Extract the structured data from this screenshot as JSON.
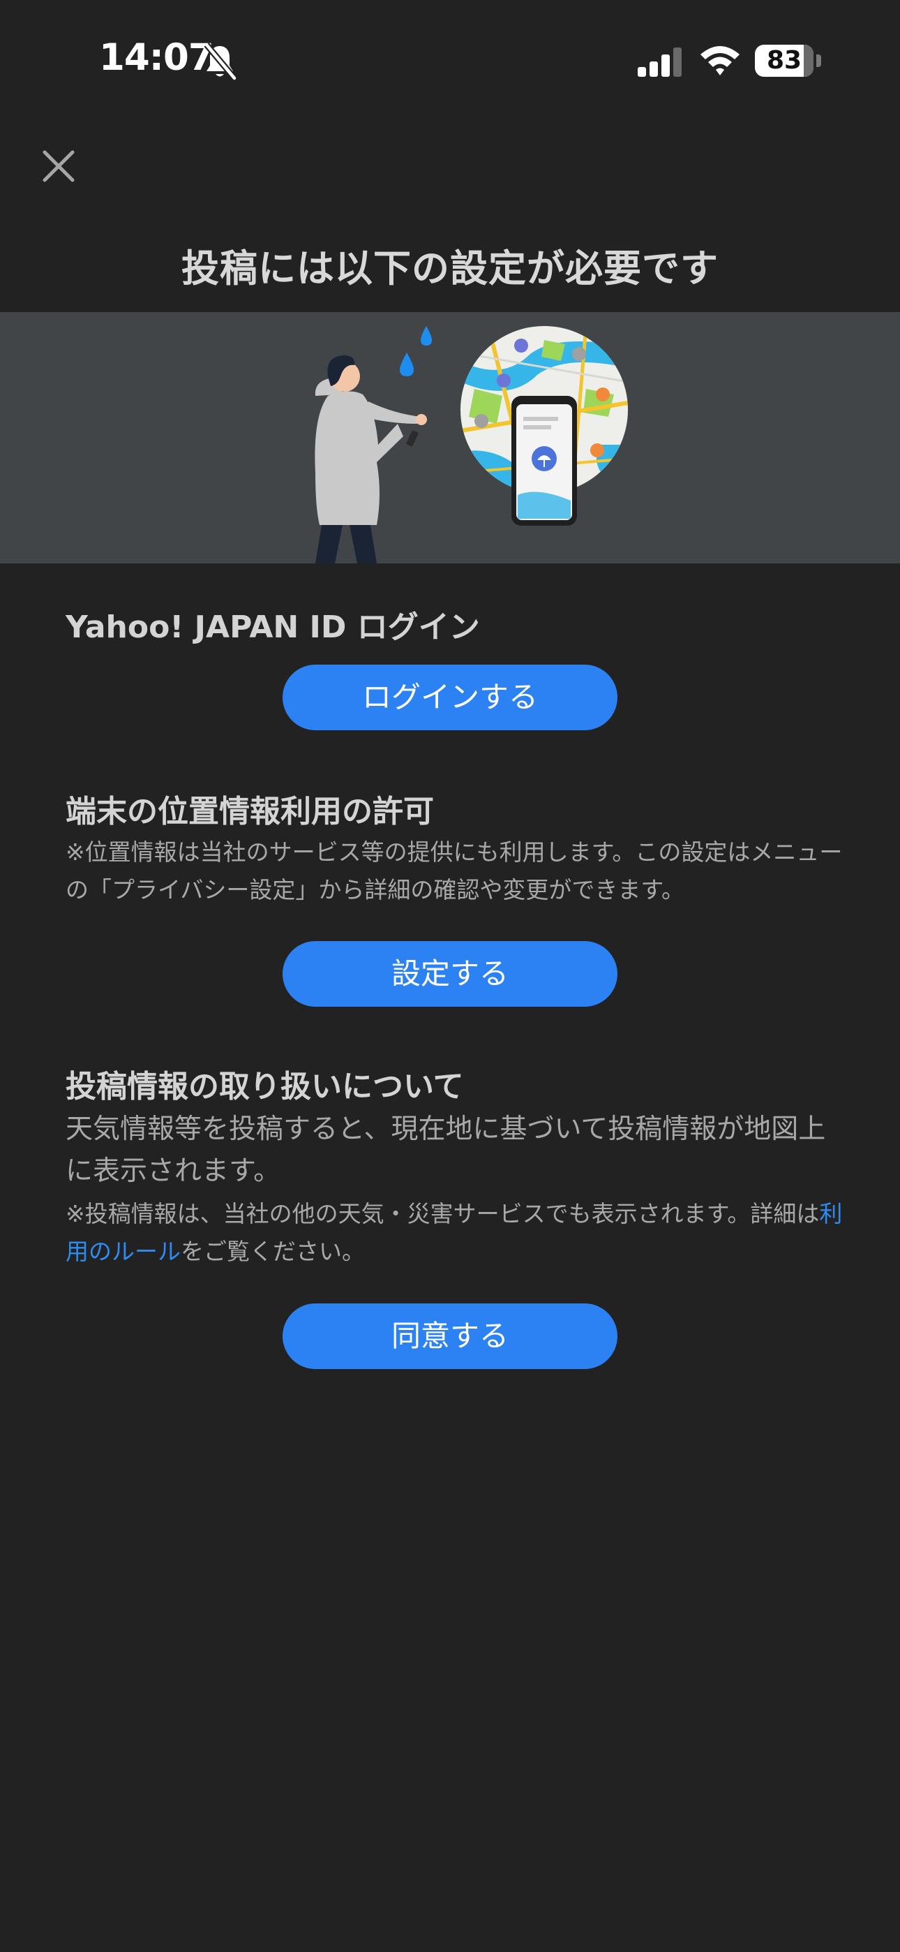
{
  "status_bar": {
    "time": "14:07",
    "battery_level": 83,
    "battery_label": "83",
    "icons": [
      "bell-off-icon",
      "signal-icon",
      "wifi-icon",
      "battery-icon"
    ]
  },
  "header": {
    "close_icon": "close-icon",
    "title": "投稿には以下の設定が必要です"
  },
  "hero": {
    "illustration": "person-in-rain-with-map-phone-illustration"
  },
  "sections": {
    "login": {
      "heading": "Yahoo! JAPAN ID ログイン",
      "button": "ログインする"
    },
    "location": {
      "heading": "端末の位置情報利用の許可",
      "note": "※位置情報は当社のサービス等の提供にも利用します。この設定はメニューの「プライバシー設定」から詳細の確認や変更ができます。",
      "button": "設定する"
    },
    "posting": {
      "heading": "投稿情報の取り扱いについて",
      "body": "天気情報等を投稿すると、現在地に基づいて投稿情報が地図上に表示されます。",
      "note_prefix": "※投稿情報は、当社の他の天気・災害サービスでも表示されます。詳細は",
      "note_link": "利用のルール",
      "note_suffix": "をご覧ください。",
      "button": "同意する"
    }
  },
  "colors": {
    "background": "#222223",
    "hero_background": "#414548",
    "button": "#2c82f2",
    "link": "#2e8cf0"
  }
}
